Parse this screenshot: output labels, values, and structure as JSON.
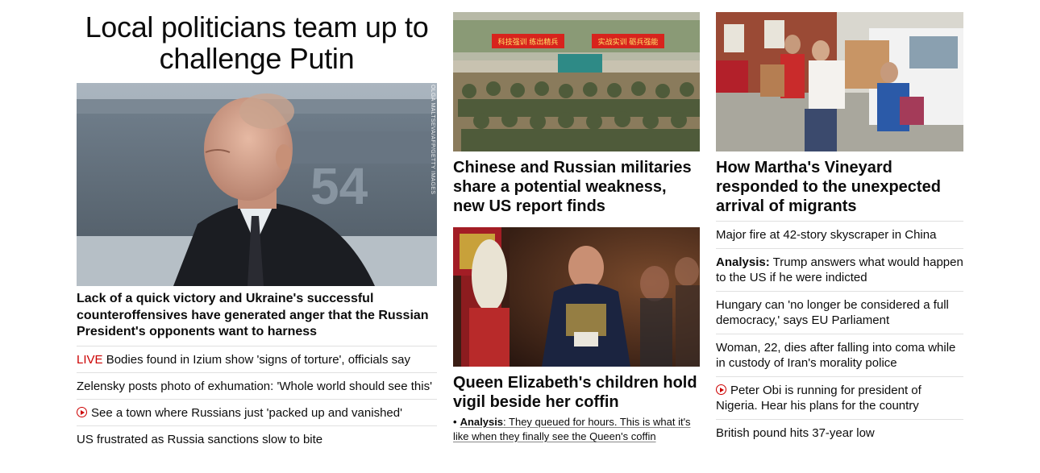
{
  "column1": {
    "title": "Local politicians team up to challenge Putin",
    "photo": {
      "credit": "OLGA MALTSEVA/AFP/GETTY IMAGES",
      "alt_subject": "Vladimir Putin in front of a grey warship"
    },
    "lead_headline": "Lack of a quick victory and Ukraine's successful counteroffensives have generated anger that the Russian President's opponents want to harness",
    "links": [
      {
        "prefix": "LIVE",
        "text": "Bodies found in Izium show 'signs of torture', officials say"
      },
      {
        "text": "Zelensky posts photo of exhumation: 'Whole world should see this'"
      },
      {
        "video": true,
        "text": "See a town where Russians just 'packed up and vanished'"
      },
      {
        "text": "US frustrated as Russia sanctions slow to bite"
      }
    ]
  },
  "column2": {
    "story1": {
      "banner_left": "科技强训 练出精兵",
      "banner_right": "实战实训 砺兵强能",
      "headline": "Chinese and Russian militaries share a potential weakness, new US report finds"
    },
    "story2": {
      "headline": "Queen Elizabeth's children hold vigil beside her coffin",
      "sub_prefix": "Analysis",
      "sub_text": ": They queued for hours. This is what it's like when they finally see the Queen's coffin"
    }
  },
  "column3": {
    "story1": {
      "headline": "How Martha's Vineyard responded to the unexpected arrival of migrants"
    },
    "links": [
      {
        "text": "Major fire at 42-story skyscraper in China"
      },
      {
        "prefix": "Analysis:",
        "text": " Trump answers what would happen to the US if he were indicted"
      },
      {
        "text": "Hungary can 'no longer be considered a full democracy,' says EU Parliament"
      },
      {
        "text": "Woman, 22, dies after falling into coma while in custody of Iran's morality police"
      },
      {
        "video": true,
        "text": "Peter Obi is running for president of Nigeria. Hear his plans for the country"
      },
      {
        "text": "British pound hits 37-year low"
      }
    ]
  },
  "colors": {
    "live_red": "#cc0000",
    "text": "#0c0c0c",
    "divider": "#e0e0e0"
  }
}
